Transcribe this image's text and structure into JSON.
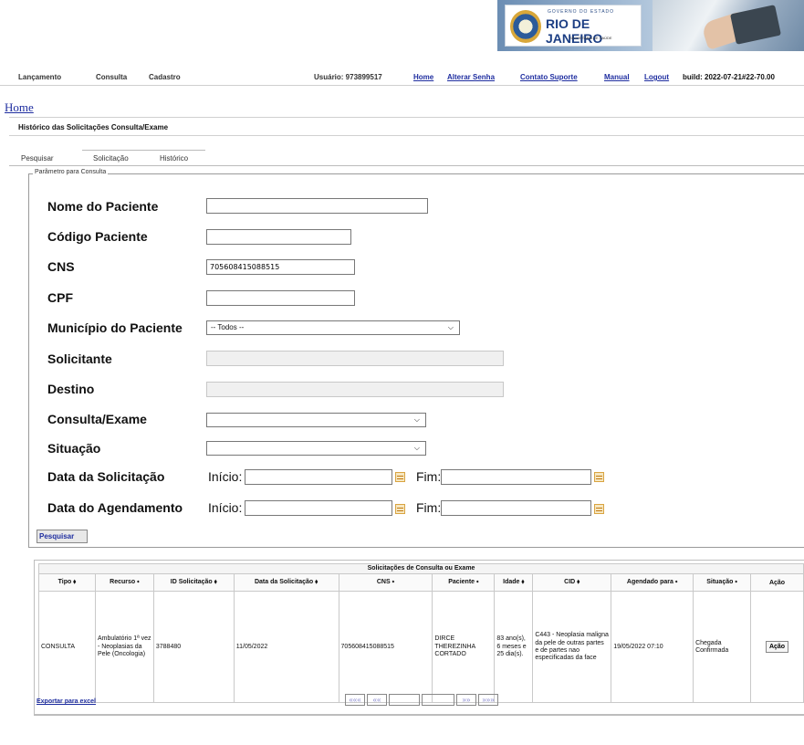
{
  "banner": {
    "gov_line1": "GOVERNO DO ESTADO",
    "gov_line2": "RIO DE JANEIRO",
    "gov_line3": "SECRETARIA DE SAÚDE"
  },
  "topnav": {
    "items": [
      "Lançamento",
      "Consulta",
      "Cadastro"
    ],
    "user": "Usuário: 973899517",
    "links": [
      "Home",
      "Alterar Senha",
      "Contato Suporte",
      "Manual",
      "Logout"
    ],
    "build": "build: 2022-07-21#22-70.00"
  },
  "home_link": "Home",
  "page_title": "Histórico das Solicitações Consulta/Exame",
  "tabs": [
    "Pesquisar",
    "Solicitação",
    "Histórico"
  ],
  "form": {
    "legend": "Parâmetro para Consulta",
    "nome_label": "Nome do Paciente",
    "nome_value": "",
    "codigo_label": "Código Paciente",
    "codigo_value": "",
    "cns_label": "CNS",
    "cns_value": "705608415088515",
    "cpf_label": "CPF",
    "cpf_value": "",
    "municipio_label": "Município do Paciente",
    "municipio_value": "-- Todos --",
    "solicitante_label": "Solicitante",
    "destino_label": "Destino",
    "consulta_label": "Consulta/Exame",
    "consulta_value": "",
    "situacao_label": "Situação",
    "situacao_value": "",
    "data_solic_label": "Data da Solicitação",
    "data_agend_label": "Data do Agendamento",
    "inicio_label": "Início:",
    "fim_label": "Fim:",
    "submit": "Pesquisar"
  },
  "results": {
    "caption": "Solicitações de Consulta ou Exame",
    "columns": [
      "Tipo ⬧",
      "Recurso ⬩",
      "ID Solicitação ⬧",
      "Data da Solicitação ⬧",
      "CNS ⬩",
      "Paciente ⬩",
      "Idade ⬧",
      "CID ⬧",
      "Agendado para ⬩",
      "Situação ⬩",
      "Ação"
    ],
    "rows": [
      {
        "tipo": "CONSULTA",
        "recurso": "Ambulatório 1ª vez - Neoplasias da Pele (Oncologia)",
        "id": "3788480",
        "data": "11/05/2022",
        "cns": "705608415088515",
        "paciente": "DIRCE THEREZINHA CORTADO",
        "idade": "83 ano(s), 6 meses e 25 dia(s).",
        "cid": "C443 - Neoplasia maligna da pele de outras partes e de partes nao especificadas da face",
        "agendado": "19/05/2022 07:10",
        "situacao": "Chegada Confirmada",
        "acao": "Ação"
      }
    ],
    "pager": {
      "first": "«««",
      "prev": "««",
      "next": "»»",
      "last": "»»»"
    },
    "export": "Exportar para excel"
  }
}
